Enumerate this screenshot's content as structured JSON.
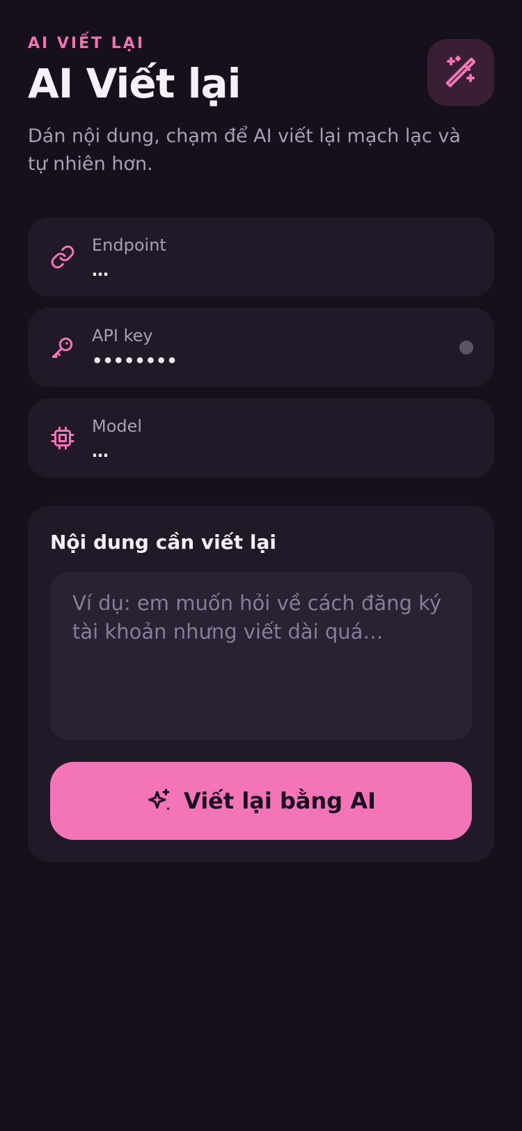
{
  "header": {
    "eyebrow": "AI VIẾT LẠI",
    "title": "AI Viết lại",
    "subtitle": "Dán nội dung, chạm để AI viết lại mạch lạc và tự nhiên hơn."
  },
  "fields": {
    "endpoint": {
      "label": "Endpoint",
      "value": "…"
    },
    "api_key": {
      "label": "API key",
      "value": "••••••••"
    },
    "model": {
      "label": "Model",
      "value": "…"
    }
  },
  "composer": {
    "title": "Nội dung cần viết lại",
    "placeholder": "Ví dụ: em muốn hỏi về cách đăng ký tài khoản nhưng viết dài quá…",
    "button_label": "Viết lại bằng AI"
  },
  "icons": {
    "hero": "magic-wand-icon",
    "endpoint": "link-icon",
    "api_key": "key-icon",
    "model": "cpu-chip-icon",
    "cta": "sparkles-icon"
  },
  "colors": {
    "background": "#15101b",
    "surface": "#211927",
    "accent": "#f474b8",
    "muted_text": "#a79fb6"
  }
}
